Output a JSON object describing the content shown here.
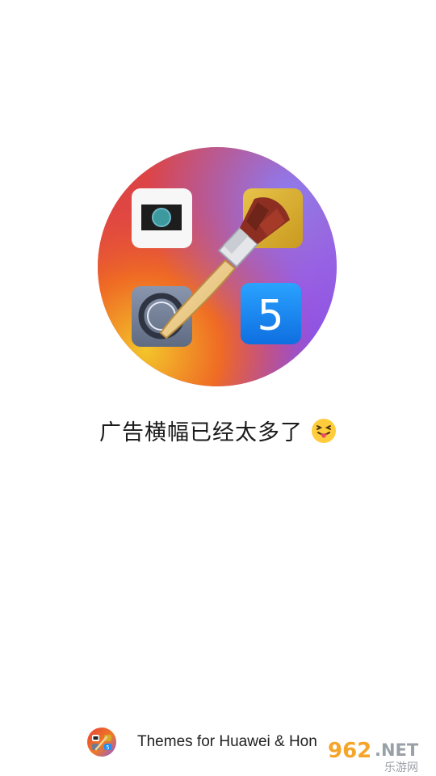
{
  "tagline": {
    "text": "广告横幅已经太多了"
  },
  "footer": {
    "app_name": "Themes for Huawei & Hon"
  },
  "watermark": {
    "number": "962",
    "suffix": ".NET",
    "sub": "乐游网"
  },
  "logo": {
    "tile_number": "5",
    "colors": {
      "purple": "#8a55e6",
      "orange": "#f07a24",
      "red": "#e5423b",
      "yellow": "#f5c72a",
      "blue": "#1f8ff2"
    }
  }
}
